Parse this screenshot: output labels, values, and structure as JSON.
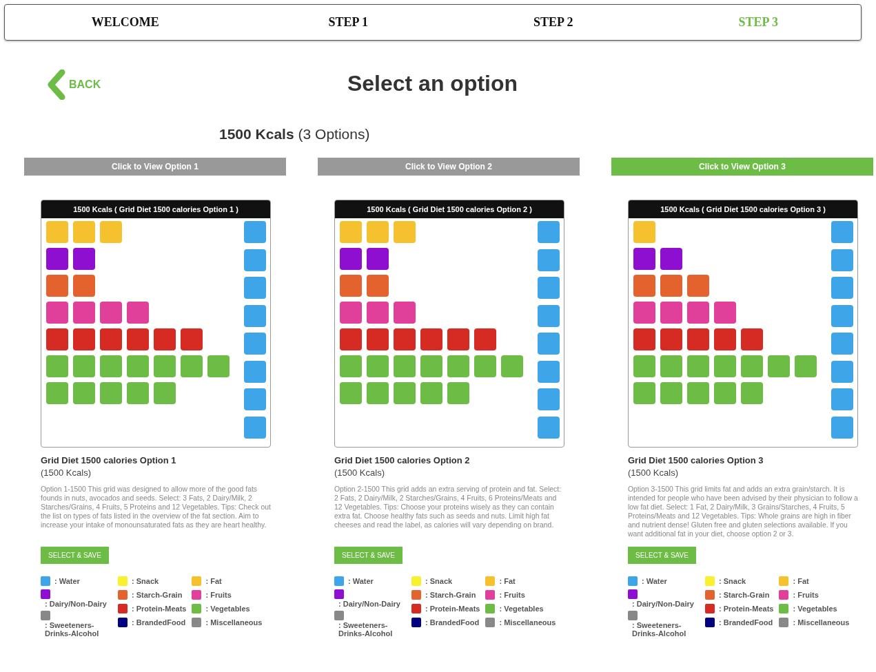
{
  "steps": [
    {
      "label": "WELCOME",
      "selected": false
    },
    {
      "label": "STEP 1",
      "selected": false
    },
    {
      "label": "STEP 2",
      "selected": false
    },
    {
      "label": "STEP 3",
      "selected": true
    }
  ],
  "back": {
    "label": "BACK"
  },
  "title": "Select an option",
  "summary": {
    "kcals": "1500 Kcals",
    "options": "(3 Options)"
  },
  "options": [
    {
      "button": "Click to View Option 1",
      "selected": false,
      "grid_title": "1500 Kcals ( Grid Diet 1500 calories Option 1 )",
      "rows": [
        [
          {
            "color": "#f5c12e"
          },
          {
            "color": "#f5c12e"
          },
          {
            "color": "#f5c12e"
          }
        ],
        [
          {
            "color": "#8e0fcf"
          },
          {
            "color": "#8e0fcf"
          }
        ],
        [
          {
            "color": "#e4622e"
          },
          {
            "color": "#e4622e"
          }
        ],
        [
          {
            "color": "#e0409a"
          },
          {
            "color": "#e0409a"
          },
          {
            "color": "#e0409a"
          },
          {
            "color": "#e0409a"
          }
        ],
        [
          {
            "color": "#d52b22"
          },
          {
            "color": "#d52b22"
          },
          {
            "color": "#d52b22"
          },
          {
            "color": "#d52b22"
          },
          {
            "color": "#d52b22"
          },
          {
            "color": "#d52b22"
          }
        ],
        [
          {
            "color": "#6cbc45"
          },
          {
            "color": "#6cbc45"
          },
          {
            "color": "#6cbc45"
          },
          {
            "color": "#6cbc45"
          },
          {
            "color": "#6cbc45"
          },
          {
            "color": "#6cbc45"
          },
          {
            "color": "#6cbc45"
          }
        ],
        [
          {
            "color": "#6cbc45"
          },
          {
            "color": "#6cbc45"
          },
          {
            "color": "#6cbc45"
          },
          {
            "color": "#6cbc45"
          },
          {
            "color": "#6cbc45"
          }
        ]
      ],
      "water": [
        {
          "color": "#3ea6e8"
        },
        {
          "color": "#3ea6e8"
        },
        {
          "color": "#3ea6e8"
        },
        {
          "color": "#3ea6e8"
        },
        {
          "color": "#3ea6e8"
        },
        {
          "color": "#3ea6e8"
        },
        {
          "color": "#3ea6e8"
        },
        {
          "color": "#3ea6e8"
        }
      ],
      "name": "Grid Diet 1500 calories Option 1",
      "kcals": "(1500 Kcals)",
      "description": "Option 1-1500 This grid was designed to allow more of the good fats founds in nuts, avocados and seeds. Select: 3 Fats, 2 Dairy/Milk, 2 Starches/Grains, 4 Fruits, 5 Proteins and 12 Vegetables. Tips: Check out the list on types of fats listed in the overview of the fat section. Aim to increase your intake of monounsaturated fats as they are heart healthy.",
      "save": "SELECT & SAVE",
      "legend": [
        [
          {
            "label": ": Water",
            "color": "#3ea6e8",
            "kind": "inline"
          },
          {
            "label": ": Dairy/Non-Dairy",
            "color": "#8e0fcf",
            "kind": "stacked"
          },
          {
            "label": ": Sweeteners-Drinks-Alcohol",
            "color": "#888888",
            "kind": "stacked"
          }
        ],
        [
          {
            "label": ": Snack",
            "color": "#f8f22e",
            "kind": "inline"
          },
          {
            "label": ": Starch-Grain",
            "color": "#e4622e",
            "kind": "inline"
          },
          {
            "label": ": Protein-Meats",
            "color": "#d52b22",
            "kind": "inline"
          },
          {
            "label": ": BrandedFood",
            "color": "#000080",
            "kind": "inline"
          }
        ],
        [
          {
            "label": ": Fat",
            "color": "#f5c12e",
            "kind": "inline"
          },
          {
            "label": ": Fruits",
            "color": "#e0409a",
            "kind": "inline"
          },
          {
            "label": ": Vegetables",
            "color": "#6cbc45",
            "kind": "inline"
          },
          {
            "label": ": Miscellaneous",
            "color": "#888888",
            "kind": "inline"
          }
        ]
      ]
    },
    {
      "button": "Click to View Option 2",
      "selected": false,
      "grid_title": "1500 Kcals ( Grid Diet 1500 calories Option 2 )",
      "rows": [
        [
          {
            "color": "#f5c12e"
          },
          {
            "color": "#f5c12e"
          },
          {
            "color": "#f5c12e"
          }
        ],
        [
          {
            "color": "#8e0fcf"
          },
          {
            "color": "#8e0fcf"
          }
        ],
        [
          {
            "color": "#e4622e"
          },
          {
            "color": "#e4622e"
          }
        ],
        [
          {
            "color": "#e0409a"
          },
          {
            "color": "#e0409a"
          },
          {
            "color": "#e0409a"
          }
        ],
        [
          {
            "color": "#d52b22"
          },
          {
            "color": "#d52b22"
          },
          {
            "color": "#d52b22"
          },
          {
            "color": "#d52b22"
          },
          {
            "color": "#d52b22"
          },
          {
            "color": "#d52b22"
          }
        ],
        [
          {
            "color": "#6cbc45"
          },
          {
            "color": "#6cbc45"
          },
          {
            "color": "#6cbc45"
          },
          {
            "color": "#6cbc45"
          },
          {
            "color": "#6cbc45"
          },
          {
            "color": "#6cbc45"
          },
          {
            "color": "#6cbc45"
          }
        ],
        [
          {
            "color": "#6cbc45"
          },
          {
            "color": "#6cbc45"
          },
          {
            "color": "#6cbc45"
          },
          {
            "color": "#6cbc45"
          },
          {
            "color": "#6cbc45"
          }
        ]
      ],
      "water": [
        {
          "color": "#3ea6e8"
        },
        {
          "color": "#3ea6e8"
        },
        {
          "color": "#3ea6e8"
        },
        {
          "color": "#3ea6e8"
        },
        {
          "color": "#3ea6e8"
        },
        {
          "color": "#3ea6e8"
        },
        {
          "color": "#3ea6e8"
        },
        {
          "color": "#3ea6e8"
        }
      ],
      "name": "Grid Diet 1500 calories Option 2",
      "kcals": "(1500 Kcals)",
      "description": "Option 2-1500 This grid adds an extra serving of protein and fat. Select: 2 Fats, 2 Dairy/Milk, 2 Starches/Grains, 4 Fruits, 6 Proteins/Meats and 12 Vegetables. Tips: Choose your proteins wisely as they can contain extra fat. Choose healthy fats such as seeds and nuts. Limit high fat cheeses and read the label, as calories will vary depending on brand.",
      "save": "SELECT & SAVE",
      "legend": [
        [
          {
            "label": ": Water",
            "color": "#3ea6e8",
            "kind": "inline"
          },
          {
            "label": ": Dairy/Non-Dairy",
            "color": "#8e0fcf",
            "kind": "stacked"
          },
          {
            "label": ": Sweeteners-Drinks-Alcohol",
            "color": "#888888",
            "kind": "stacked"
          }
        ],
        [
          {
            "label": ": Snack",
            "color": "#f8f22e",
            "kind": "inline"
          },
          {
            "label": ": Starch-Grain",
            "color": "#e4622e",
            "kind": "inline"
          },
          {
            "label": ": Protein-Meats",
            "color": "#d52b22",
            "kind": "inline"
          },
          {
            "label": ": BrandedFood",
            "color": "#000080",
            "kind": "inline"
          }
        ],
        [
          {
            "label": ": Fat",
            "color": "#f5c12e",
            "kind": "inline"
          },
          {
            "label": ": Fruits",
            "color": "#e0409a",
            "kind": "inline"
          },
          {
            "label": ": Vegetables",
            "color": "#6cbc45",
            "kind": "inline"
          },
          {
            "label": ": Miscellaneous",
            "color": "#888888",
            "kind": "inline"
          }
        ]
      ]
    },
    {
      "button": "Click to View Option 3",
      "selected": true,
      "grid_title": "1500 Kcals ( Grid Diet 1500 calories Option 3 )",
      "rows": [
        [
          {
            "color": "#f5c12e"
          }
        ],
        [
          {
            "color": "#8e0fcf"
          },
          {
            "color": "#8e0fcf"
          }
        ],
        [
          {
            "color": "#e4622e"
          },
          {
            "color": "#e4622e"
          },
          {
            "color": "#e4622e"
          }
        ],
        [
          {
            "color": "#e0409a"
          },
          {
            "color": "#e0409a"
          },
          {
            "color": "#e0409a"
          },
          {
            "color": "#e0409a"
          }
        ],
        [
          {
            "color": "#d52b22"
          },
          {
            "color": "#d52b22"
          },
          {
            "color": "#d52b22"
          },
          {
            "color": "#d52b22"
          },
          {
            "color": "#d52b22"
          }
        ],
        [
          {
            "color": "#6cbc45"
          },
          {
            "color": "#6cbc45"
          },
          {
            "color": "#6cbc45"
          },
          {
            "color": "#6cbc45"
          },
          {
            "color": "#6cbc45"
          },
          {
            "color": "#6cbc45"
          },
          {
            "color": "#6cbc45"
          }
        ],
        [
          {
            "color": "#6cbc45"
          },
          {
            "color": "#6cbc45"
          },
          {
            "color": "#6cbc45"
          },
          {
            "color": "#6cbc45"
          },
          {
            "color": "#6cbc45"
          }
        ]
      ],
      "water": [
        {
          "color": "#3ea6e8"
        },
        {
          "color": "#3ea6e8"
        },
        {
          "color": "#3ea6e8"
        },
        {
          "color": "#3ea6e8"
        },
        {
          "color": "#3ea6e8"
        },
        {
          "color": "#3ea6e8"
        },
        {
          "color": "#3ea6e8"
        },
        {
          "color": "#3ea6e8"
        }
      ],
      "name": "Grid Diet 1500 calories Option 3",
      "kcals": "(1500 Kcals)",
      "description": "Option 3-1500 This grid limits fat and adds an extra grain/starch. It is intended for people who have been advised by their physician to follow a low fat diet. Select: 1 Fat, 2 Dairy/Milk, 3 Grains/Starches, 4 Fruits, 5 Proteins/Meats and 12 Vegetables. Tips: Whole grains are high in fiber and nutrient dense! Gluten free and gluten selections available. If you want additional fat in your diet, choose option 2 or 3.",
      "save": "SELECT & SAVE",
      "legend": [
        [
          {
            "label": ": Water",
            "color": "#3ea6e8",
            "kind": "inline"
          },
          {
            "label": ": Dairy/Non-Dairy",
            "color": "#8e0fcf",
            "kind": "stacked"
          },
          {
            "label": ": Sweeteners-Drinks-Alcohol",
            "color": "#888888",
            "kind": "stacked"
          }
        ],
        [
          {
            "label": ": Snack",
            "color": "#f8f22e",
            "kind": "inline"
          },
          {
            "label": ": Starch-Grain",
            "color": "#e4622e",
            "kind": "inline"
          },
          {
            "label": ": Protein-Meats",
            "color": "#d52b22",
            "kind": "inline"
          },
          {
            "label": ": BrandedFood",
            "color": "#000080",
            "kind": "inline"
          }
        ],
        [
          {
            "label": ": Fat",
            "color": "#f5c12e",
            "kind": "inline"
          },
          {
            "label": ": Fruits",
            "color": "#e0409a",
            "kind": "inline"
          },
          {
            "label": ": Vegetables",
            "color": "#6cbc45",
            "kind": "inline"
          },
          {
            "label": ": Miscellaneous",
            "color": "#888888",
            "kind": "inline"
          }
        ]
      ]
    }
  ]
}
